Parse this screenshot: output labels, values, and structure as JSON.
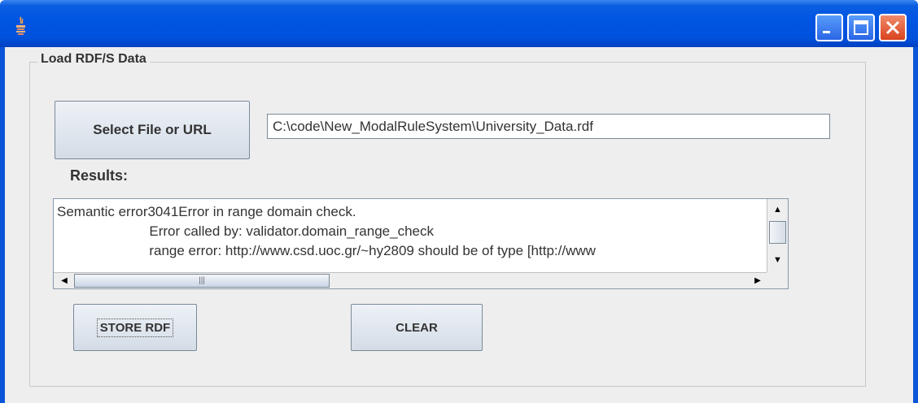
{
  "window": {
    "title": "",
    "icon": "java-cup-icon",
    "controls": [
      "minimize-icon",
      "maximize-icon",
      "close-icon"
    ]
  },
  "panel": {
    "title": "Load RDF/S Data"
  },
  "file_select": {
    "button_label": "Select File or URL",
    "path_value": "C:\\code\\New_ModalRuleSystem\\University_Data.rdf"
  },
  "results": {
    "label": "Results:",
    "text": "Semantic error3041Error in range domain check.\n                        Error called by: validator.domain_range_check\n                        range error: http://www.csd.uoc.gr/~hy2809 should be of type [http://www"
  },
  "actions": {
    "store_label": "STORE RDF",
    "clear_label": "CLEAR"
  },
  "colors": {
    "titlebar": "#0054e3",
    "background": "#eeeeee",
    "close_button": "#d9431f"
  }
}
